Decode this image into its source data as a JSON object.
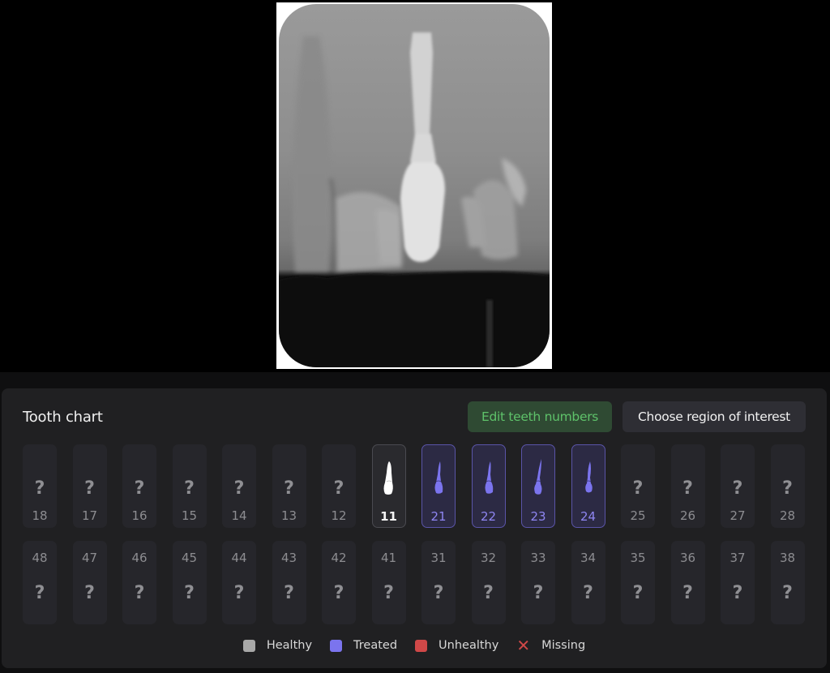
{
  "viewer": {
    "image_alt": "Dental periapical X-ray showing implant crown"
  },
  "panel": {
    "title": "Tooth chart",
    "buttons": {
      "edit_teeth": "Edit teeth numbers",
      "choose_roi": "Choose region of interest"
    }
  },
  "upper_row": [
    {
      "number": "18",
      "status": "unknown"
    },
    {
      "number": "17",
      "status": "unknown"
    },
    {
      "number": "16",
      "status": "unknown"
    },
    {
      "number": "15",
      "status": "unknown"
    },
    {
      "number": "14",
      "status": "unknown"
    },
    {
      "number": "13",
      "status": "unknown"
    },
    {
      "number": "12",
      "status": "unknown"
    },
    {
      "number": "11",
      "status": "healthy"
    },
    {
      "number": "21",
      "status": "treated"
    },
    {
      "number": "22",
      "status": "treated"
    },
    {
      "number": "23",
      "status": "treated"
    },
    {
      "number": "24",
      "status": "treated"
    },
    {
      "number": "25",
      "status": "unknown"
    },
    {
      "number": "26",
      "status": "unknown"
    },
    {
      "number": "27",
      "status": "unknown"
    },
    {
      "number": "28",
      "status": "unknown"
    }
  ],
  "lower_row": [
    {
      "number": "48",
      "status": "unknown"
    },
    {
      "number": "47",
      "status": "unknown"
    },
    {
      "number": "46",
      "status": "unknown"
    },
    {
      "number": "45",
      "status": "unknown"
    },
    {
      "number": "44",
      "status": "unknown"
    },
    {
      "number": "43",
      "status": "unknown"
    },
    {
      "number": "42",
      "status": "unknown"
    },
    {
      "number": "41",
      "status": "unknown"
    },
    {
      "number": "31",
      "status": "unknown"
    },
    {
      "number": "32",
      "status": "unknown"
    },
    {
      "number": "33",
      "status": "unknown"
    },
    {
      "number": "34",
      "status": "unknown"
    },
    {
      "number": "35",
      "status": "unknown"
    },
    {
      "number": "36",
      "status": "unknown"
    },
    {
      "number": "37",
      "status": "unknown"
    },
    {
      "number": "38",
      "status": "unknown"
    }
  ],
  "unknown_glyph": "?",
  "legend": [
    {
      "label": "Healthy",
      "color": "#a8a8a8",
      "icon": "square"
    },
    {
      "label": "Treated",
      "color": "#7b74ee",
      "icon": "square"
    },
    {
      "label": "Unhealthy",
      "color": "#d04848",
      "icon": "square"
    },
    {
      "label": "Missing",
      "color": "#d04848",
      "icon": "x-mark",
      "glyph": "✕"
    }
  ],
  "colors": {
    "healthy": "#ffffff",
    "treated": "#7b74ee",
    "accent_green": "#5ec26a"
  }
}
